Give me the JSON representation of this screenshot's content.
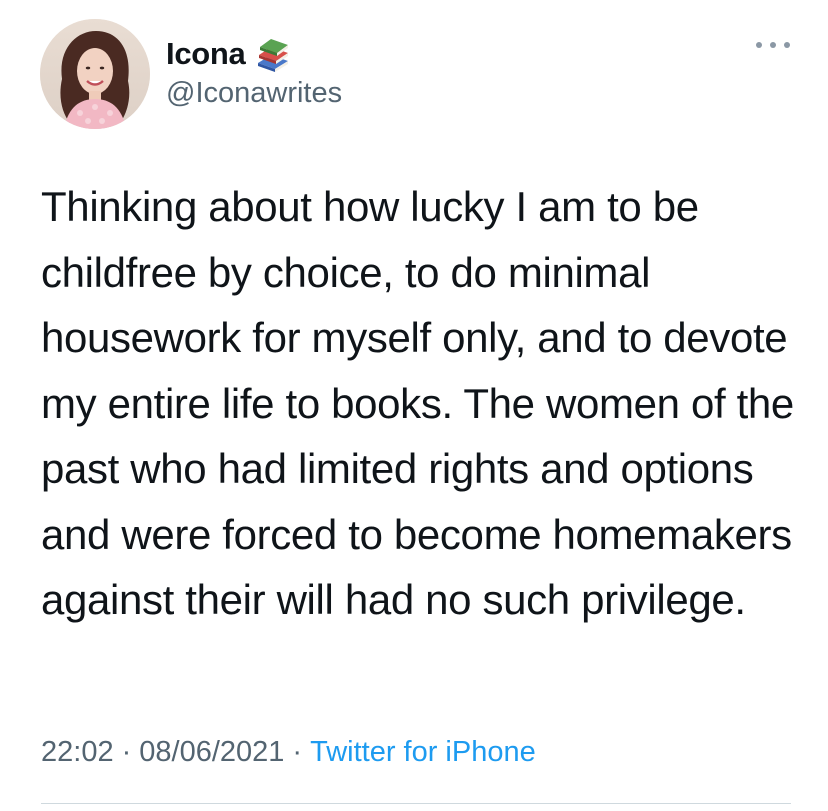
{
  "tweet": {
    "author": {
      "display_name": "Icona",
      "name_emoji_icon": "books-icon",
      "handle": "@Iconawrites"
    },
    "more_icon": "more-horizontal-icon",
    "text": "Thinking about how lucky I am to be childfree by choice, to do minimal housework for myself only, and to devote my entire life to books. The women of the past who had limited rights and options and were forced to become homemakers against their will had no such privilege.",
    "time": "22:02",
    "date": "08/06/2021",
    "separator": "·",
    "source": "Twitter for iPhone",
    "colors": {
      "text": "#0f1419",
      "secondary": "#536471",
      "link": "#1d9bf0",
      "divider": "#cfd9de"
    }
  }
}
